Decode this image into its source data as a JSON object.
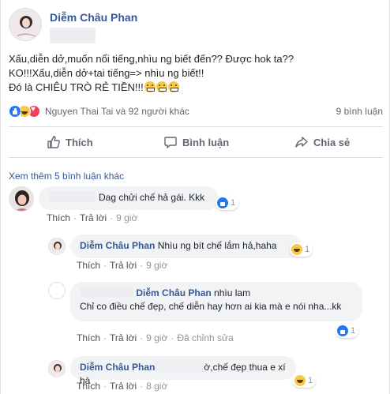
{
  "post": {
    "author": "Diễm Châu Phan",
    "lines": [
      "Xấu,diễn dở,muốn nổi tiếng,nhìu ng biết đến?? Được hok ta??",
      "KO!!!Xấu,diễn dở+tai tiếng=> nhìu ng biết!!",
      "Đó là CHIÊU TRÒ RẺ TIỀN!!!"
    ],
    "reactions": {
      "icons": [
        "like-icon",
        "haha-icon",
        "love-icon"
      ],
      "names": "Nguyen Thai Tai và 92 người khác",
      "comment_count": "9 bình luận"
    },
    "actions": {
      "like": "Thích",
      "comment": "Bình luận",
      "share": "Chia sẻ"
    }
  },
  "comments": {
    "more_link": "Xem thêm 5 bình luận khác",
    "like_label": "Thích",
    "reply_label": "Trả lời",
    "items": [
      {
        "text": "Dag chửi chế hả gái. Kkk",
        "time": "9 giờ",
        "reaction_icon": "like-icon",
        "reaction_count": "1"
      },
      {
        "author": "Diễm Châu Phan",
        "text": "Nhìu ng bít chế lắm hả,haha",
        "time": "9 giờ",
        "reaction_icon": "haha-icon",
        "reaction_count": "1"
      },
      {
        "mention": "Diễm Châu Phan",
        "text_inline": "nhìu lam",
        "text": "Chỉ co điều chế đẹp, chế diễn hay hơn ai kia mà e nói nha...kk",
        "time": "9 giờ",
        "edited": "Đã chỉnh sửa",
        "reaction_icon": "like-icon",
        "reaction_count": "1"
      },
      {
        "author": "Diễm Châu Phan",
        "text": "ờ,chế đẹp thua e xí hà",
        "time": "8 giờ",
        "reaction_icon": "haha-icon",
        "reaction_count": "1"
      }
    ]
  },
  "colors": {
    "link": "#365899",
    "text": "#1d2129",
    "muted": "#606770",
    "bubble": "#f2f3f5",
    "like_blue": "#2078f4"
  }
}
